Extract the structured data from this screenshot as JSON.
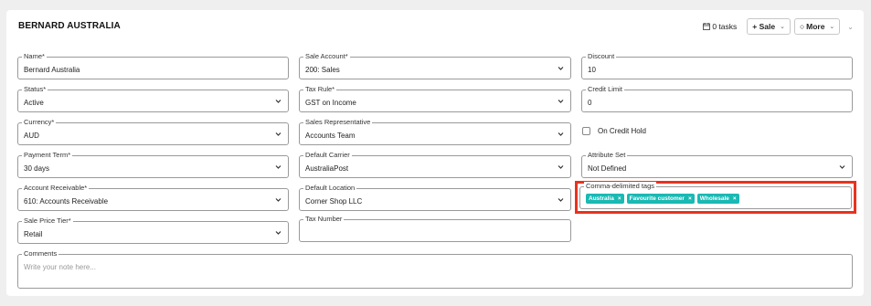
{
  "header": {
    "title": "BERNARD AUSTRALIA",
    "tasks_label": "0 tasks",
    "sale_button": "+ Sale",
    "more_button": "More"
  },
  "fields": {
    "name": {
      "label": "Name*",
      "value": "Bernard Australia"
    },
    "sale_account": {
      "label": "Sale Account*",
      "value": "200: Sales"
    },
    "discount": {
      "label": "Discount",
      "value": "10"
    },
    "status": {
      "label": "Status*",
      "value": "Active"
    },
    "tax_rule": {
      "label": "Tax Rule*",
      "value": "GST on Income"
    },
    "credit_limit": {
      "label": "Credit Limit",
      "value": "0"
    },
    "currency": {
      "label": "Currency*",
      "value": "AUD"
    },
    "sales_rep": {
      "label": "Sales Representative",
      "value": "Accounts Team"
    },
    "on_credit_hold": {
      "label": "On Credit Hold",
      "checked": false
    },
    "payment_term": {
      "label": "Payment Term*",
      "value": "30 days"
    },
    "default_carrier": {
      "label": "Default Carrier",
      "value": "AustraliaPost"
    },
    "attribute_set": {
      "label": "Attribute Set",
      "value": "Not Defined"
    },
    "account_receivable": {
      "label": "Account Receivable*",
      "value": "610: Accounts Receivable"
    },
    "default_location": {
      "label": "Default Location",
      "value": "Corner Shop LLC"
    },
    "tags": {
      "label": "Comma-delimited tags",
      "items": [
        "Australia",
        "Favourite customer",
        "Wholesale"
      ]
    },
    "sale_price_tier": {
      "label": "Sale Price Tier*",
      "value": "Retail"
    },
    "tax_number": {
      "label": "Tax Number",
      "value": ""
    },
    "comments": {
      "label": "Comments",
      "placeholder": "Write your note here..."
    }
  },
  "colors": {
    "tag": "#1ab9b4",
    "highlight": "#e8321e"
  }
}
